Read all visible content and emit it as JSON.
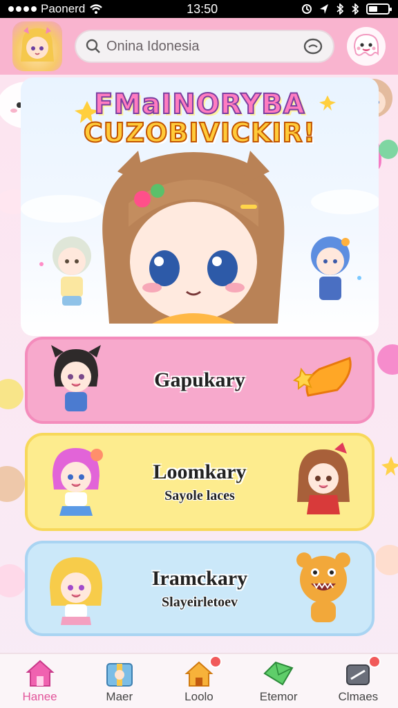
{
  "status_bar": {
    "carrier": "Paonerd",
    "time": "13:50"
  },
  "header": {
    "search_text": "Onina Idonesia",
    "search_icon": "search-icon",
    "right_icon": "ghost-icon"
  },
  "hero": {
    "title_line1": "FMaINORYBA",
    "title_line2": "CUZOBIVICKIR!"
  },
  "cards": [
    {
      "title": "Gapukary",
      "subtitle": "",
      "color": "#f7a9cc"
    },
    {
      "title": "Loomkary",
      "subtitle": "Sayole laces",
      "color": "#fdec8e"
    },
    {
      "title": "Iramckary",
      "subtitle": "Slayeirletoev",
      "color": "#cbe8f9"
    }
  ],
  "nav": {
    "items": [
      {
        "label": "Hanee",
        "icon": "home-icon",
        "active": true
      },
      {
        "label": "Maer",
        "icon": "gift-icon",
        "active": false
      },
      {
        "label": "Loolo",
        "icon": "house-icon",
        "active": false
      },
      {
        "label": "Etemor",
        "icon": "gem-icon",
        "active": false
      },
      {
        "label": "Clmaes",
        "icon": "box-icon",
        "active": false
      }
    ]
  },
  "colors": {
    "header_bg": "#f9b4cf",
    "accent_pink": "#e2549a"
  }
}
